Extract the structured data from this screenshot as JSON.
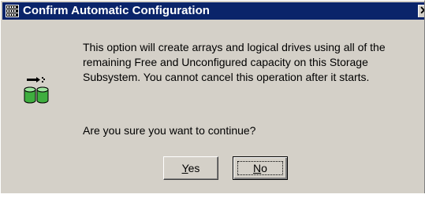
{
  "window": {
    "title": "Confirm Automatic Configuration",
    "close_glyph": "✕"
  },
  "message": {
    "body": "This option will create arrays and logical drives using all of the remaining Free and Unconfigured capacity on this Storage Subsystem. You cannot cancel this operation after it starts.",
    "question": "Are you sure you want to continue?"
  },
  "buttons": {
    "yes": {
      "mnemonic": "Y",
      "rest": "es"
    },
    "no": {
      "mnemonic": "N",
      "rest": "o"
    }
  },
  "icons": {
    "title": "storage-manager-icon",
    "dialog": "drives-configuration-icon"
  },
  "colors": {
    "titlebar": "#0a246a",
    "dialog_bg": "#d4d0c8",
    "drive_green": "#3fae3f"
  }
}
